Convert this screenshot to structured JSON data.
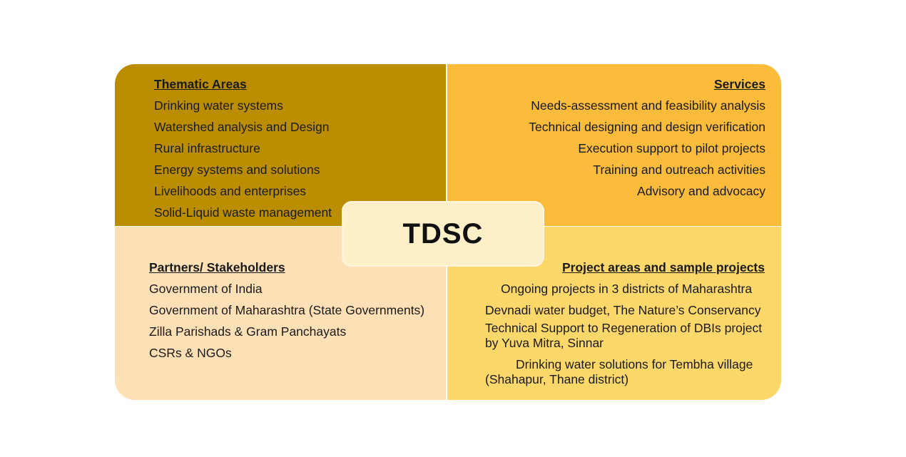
{
  "center_label": "TDSC",
  "thematic": {
    "heading": "Thematic Areas",
    "items": [
      "Drinking water systems",
      "Watershed analysis and Design",
      "Rural infrastructure",
      "Energy systems and solutions",
      "Livelihoods and enterprises",
      "Solid-Liquid waste management"
    ]
  },
  "services": {
    "heading": "Services",
    "items": [
      "Needs-assessment and feasibility analysis",
      "Technical designing and design verification",
      "Execution support to pilot projects",
      "Training and outreach activities",
      "Advisory and advocacy"
    ]
  },
  "partners": {
    "heading": "Partners/ Stakeholders",
    "items": [
      "Government of India",
      "Government of Maharashtra (State Governments)",
      "Zilla Parishads & Gram Panchayats",
      "CSRs & NGOs"
    ]
  },
  "projects": {
    "heading": "Project areas and sample projects",
    "items": [
      "Ongoing projects in 3  districts of Maharashtra",
      "Devnadi water budget, The Nature’s Conservancy",
      "Technical Support to Regeneration of DBIs project by Yuva Mitra, Sinnar",
      "Drinking water solutions for Tembha village (Shahapur, Thane district)"
    ]
  },
  "colors": {
    "thematic_bg": "#bb8d00",
    "services_bg": "#fbbb3b",
    "partners_bg": "#fde0b5",
    "projects_bg": "#fcd76a",
    "center_bg": "#fdf0c9"
  }
}
